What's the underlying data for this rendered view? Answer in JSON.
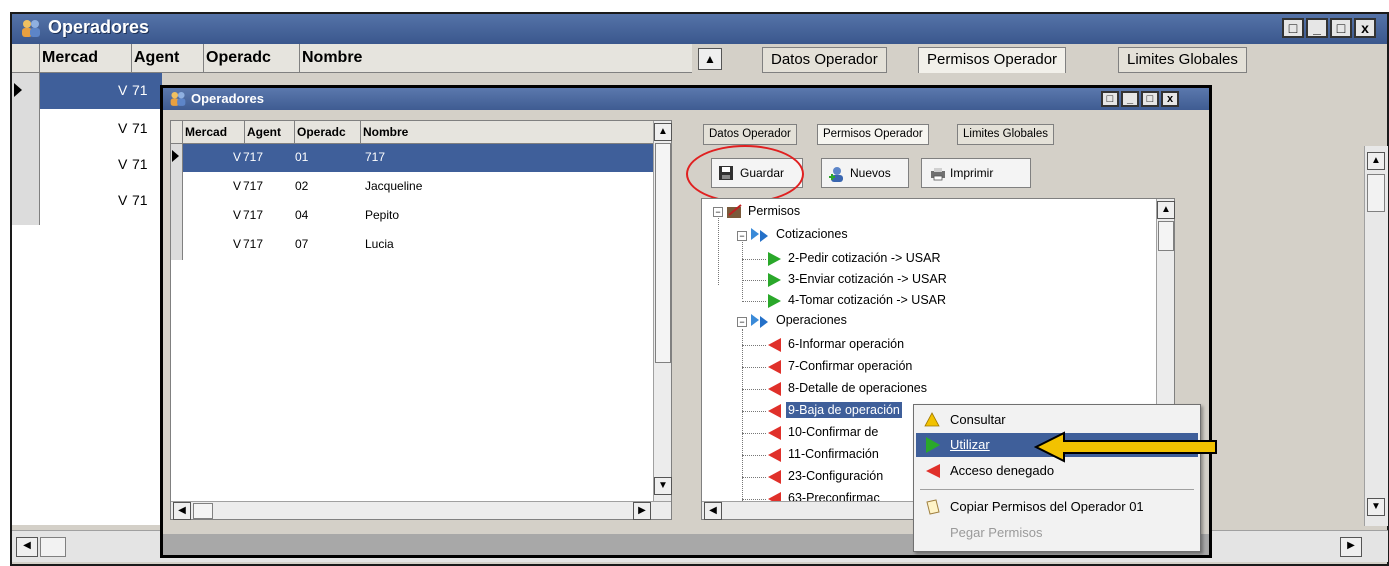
{
  "outer_window": {
    "title": "Operadores",
    "grid_headers": [
      "Mercad",
      "Agent",
      "Operadc",
      "Nombre"
    ],
    "rows_visible": [
      {
        "mercado": "V",
        "agente": "71"
      },
      {
        "mercado": "V",
        "agente": "71"
      },
      {
        "mercado": "V",
        "agente": "71"
      },
      {
        "mercado": "V",
        "agente": "71"
      }
    ],
    "tabs": [
      "Datos Operador",
      "Permisos Operador",
      "Limites Globales"
    ],
    "active_tab": "Permisos Operador",
    "window_buttons": [
      "□",
      "_",
      "□",
      "x"
    ]
  },
  "inner_window": {
    "title": "Operadores",
    "grid_headers": [
      "Mercad",
      "Agent",
      "Operadc",
      "Nombre"
    ],
    "rows": [
      {
        "mercado": "V",
        "agente": "717",
        "operador": "01",
        "nombre": "717",
        "selected": true
      },
      {
        "mercado": "V",
        "agente": "717",
        "operador": "02",
        "nombre": "Jacqueline",
        "selected": false
      },
      {
        "mercado": "V",
        "agente": "717",
        "operador": "04",
        "nombre": "Pepito",
        "selected": false
      },
      {
        "mercado": "V",
        "agente": "717",
        "operador": "07",
        "nombre": "Lucia",
        "selected": false
      }
    ],
    "tabs": [
      "Datos Operador",
      "Permisos Operador",
      "Limites Globales"
    ],
    "active_tab": "Permisos Operador",
    "toolbar": {
      "guardar": "Guardar",
      "nuevos": "Nuevos",
      "imprimir": "Imprimir"
    },
    "tree": {
      "root": "Permisos",
      "groups": [
        {
          "label": "Cotizaciones",
          "items": [
            {
              "label": "2-Pedir cotización -> USAR",
              "status": "granted"
            },
            {
              "label": "3-Enviar cotización -> USAR",
              "status": "granted"
            },
            {
              "label": "4-Tomar cotización -> USAR",
              "status": "granted"
            }
          ]
        },
        {
          "label": "Operaciones",
          "items": [
            {
              "label": "6-Informar operación",
              "status": "denied"
            },
            {
              "label": "7-Confirmar operación",
              "status": "denied"
            },
            {
              "label": "8-Detalle de operaciones",
              "status": "denied"
            },
            {
              "label": "9-Baja de operación",
              "status": "denied",
              "selected": true
            },
            {
              "label": "10-Confirmar de",
              "status": "denied"
            },
            {
              "label": "11-Confirmación",
              "status": "denied"
            },
            {
              "label": "23-Configuración",
              "status": "denied"
            },
            {
              "label": "63-Preconfirmac",
              "status": "denied"
            }
          ]
        }
      ]
    }
  },
  "context_menu": {
    "items": [
      {
        "label": "Consultar",
        "icon": "warning-icon"
      },
      {
        "label": "Utilizar",
        "icon": "green-arrow-icon",
        "selected": true
      },
      {
        "label": "Acceso denegado",
        "icon": "red-arrow-icon"
      },
      {
        "label": "Copiar Permisos del Operador 01",
        "icon": "copy-icon"
      },
      {
        "label": "Pegar Permisos",
        "icon": "",
        "disabled": true
      }
    ]
  },
  "colors": {
    "titlebar": "#3f5c92",
    "highlight_circle": "#e02020",
    "pointer_arrow": "#f2c200",
    "selection": "#3f5f9a"
  }
}
